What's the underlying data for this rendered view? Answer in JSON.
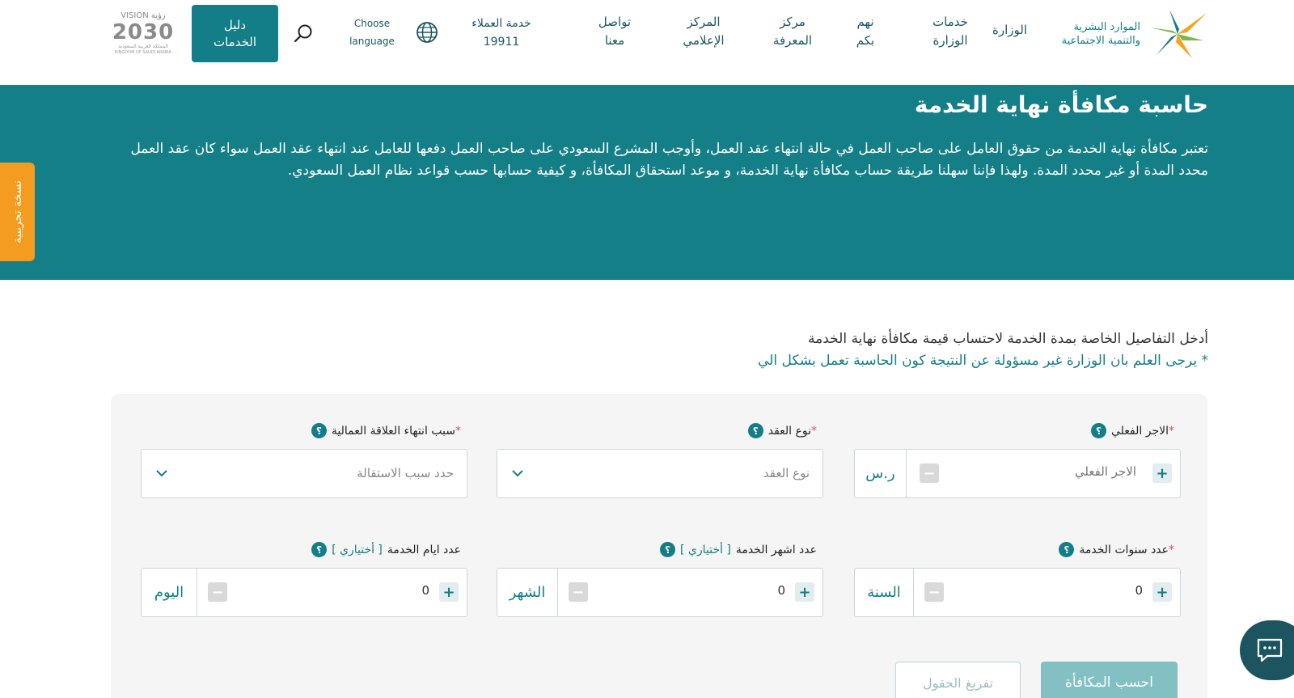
{
  "header": {
    "logo_text_line1": "الموارد البشرية",
    "logo_text_line2": "والتنمية الاجتماعية",
    "nav": {
      "ministry": "الوزارة",
      "services": "خدمات\nالوزارة",
      "care": "نهم\nبكم",
      "knowledge": "مركز\nالمعرفة",
      "media": "المركز\nالإعلامي",
      "contact": "تواصل\nمعنا",
      "customer_service": "خدمة العملاء\n19911"
    },
    "language_label": "Choose\nlanguage",
    "services_guide": "دليل\nالخدمات",
    "vision_top": "VISION رؤية",
    "vision_year": "2030",
    "vision_sub": "المملكة العربية السعودية",
    "vision_en": "KINGDOM OF SAUDI ARABIA"
  },
  "hero": {
    "title": "حاسبة مكافأة نهاية الخدمة",
    "description": "تعتبر مكافأة نهاية الخدمة من حقوق العامل على صاحب العمل في حالة انتهاء عقد العمل، وأوجب المشرع السعودي على صاحب العمل دفعها للعامل عند انتهاء عقد العمل سواء كان عقد العمل محدد المدة أو غير محدد المدة. ولهذا فإننا سهلنا طريقة حساب مكافأة نهاية الخدمة، و موعد استحقاق المكافأة، و كيفية حسابها حسب قواعد نظام العمل السعودي."
  },
  "side_tab": "نسخة تجريبية",
  "intro": {
    "title": "أدخل التفاصيل الخاصة بمدة الخدمة لاحتساب قيمة مكافأة نهاية الخدمة",
    "note": "* يرجى العلم بان الوزارة غير مسؤولة عن النتيجة كون الحاسبة تعمل بشكل الي"
  },
  "form": {
    "actual_wage": {
      "label": "الاجر الفعلي",
      "required": "*",
      "placeholder": "الاجر الفعلي",
      "unit": "ر.س"
    },
    "contract_type": {
      "label": "نوع العقد",
      "required": "*",
      "placeholder": "نوع العقد"
    },
    "end_reason": {
      "label": "سبب انتهاء العلاقة العمالية",
      "required": "*",
      "placeholder": "حدد سبب الاستقالة"
    },
    "years": {
      "label": "عدد سنوات الخدمة",
      "required": "*",
      "value": "0",
      "unit": "السنة"
    },
    "months": {
      "label": "عدد اشهر الخدمة",
      "optional": "[ أختياري ]",
      "value": "0",
      "unit": "الشهر"
    },
    "days": {
      "label": "عدد ايام الخدمة",
      "optional": "[ أختياري ]",
      "value": "0",
      "unit": "اليوم"
    },
    "help_glyph": "؟",
    "plus_glyph": "+",
    "minus_glyph": "−"
  },
  "buttons": {
    "calculate": "احسب المكافأة",
    "clear": "تفريغ الحقول"
  },
  "colors": {
    "primary": "#137d88",
    "hero_bg": "#147f87",
    "side_tab": "#f39c1f",
    "required": "#d9534f",
    "chat": "#1c5560"
  },
  "icons": {
    "globe": "globe-icon",
    "search": "search-icon",
    "chevron": "chevron-down-icon",
    "chat": "chat-icon"
  }
}
